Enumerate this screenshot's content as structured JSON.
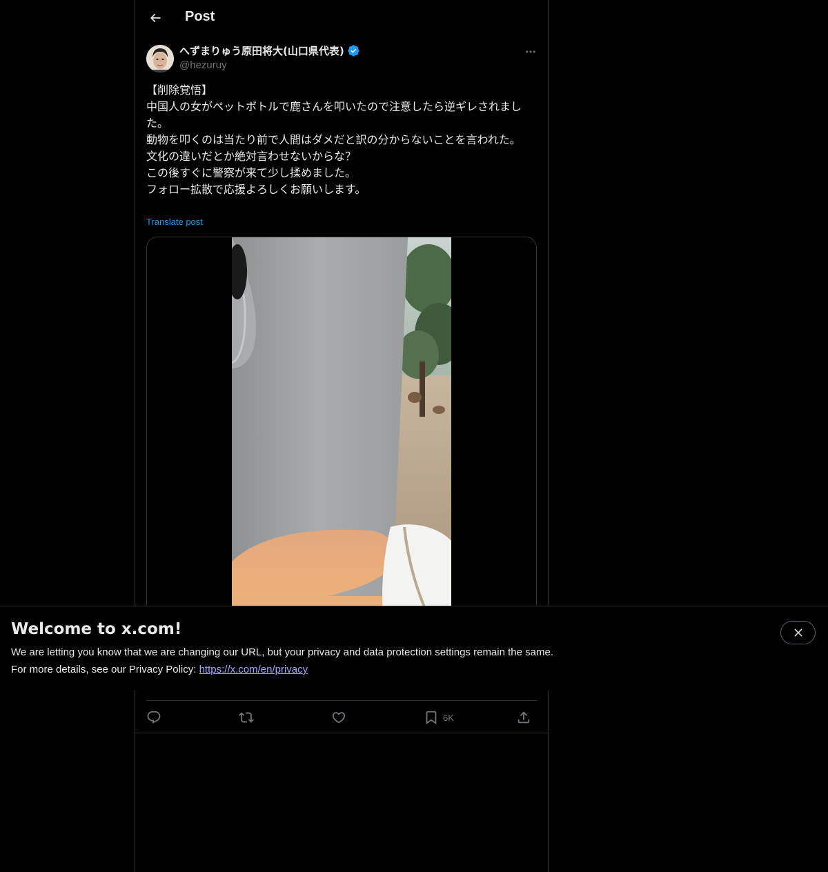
{
  "header": {
    "title": "Post"
  },
  "post": {
    "author": {
      "display_name": "へずまりゅう原田将大(山口県代表)",
      "handle": "@hezuruy",
      "verified": true
    },
    "text_lines": [
      "【削除覚悟】",
      "中国人の女がペットボトルで鹿さんを叩いたので注意したら逆ギレされました。",
      "動物を叩くのは当たり前で人間はダメだと訳の分からないことを言われた。",
      "文化の違いだとか絶対言わせないからな？",
      "この後すぐに警察が来て少し揉めました。",
      "フォロー拡散で応援よろしくお願いします。"
    ],
    "translate_label": "Translate post",
    "actions": {
      "reply_count": "",
      "repost_count": "",
      "like_count": "",
      "bookmark_count": "6K",
      "share_count": ""
    }
  },
  "banner": {
    "title": "Welcome to x.com!",
    "line1": "We are letting you know that we are changing our URL, but your privacy and data protection settings remain the same.",
    "line2_prefix": "For more details, see our Privacy Policy: ",
    "link_text": "https://x.com/en/privacy"
  },
  "colors": {
    "background": "#000000",
    "text": "#e7e9ea",
    "secondary_text": "#71767b",
    "accent": "#1d9bf0",
    "border": "#2f3336",
    "link": "#a0a6ff"
  },
  "icons": {
    "back": "arrow-left-icon",
    "more": "more-horizontal-icon",
    "verified": "verified-badge-icon",
    "reply": "reply-icon",
    "repost": "repost-icon",
    "like": "heart-icon",
    "bookmark": "bookmark-icon",
    "share": "share-icon",
    "close": "close-icon"
  }
}
